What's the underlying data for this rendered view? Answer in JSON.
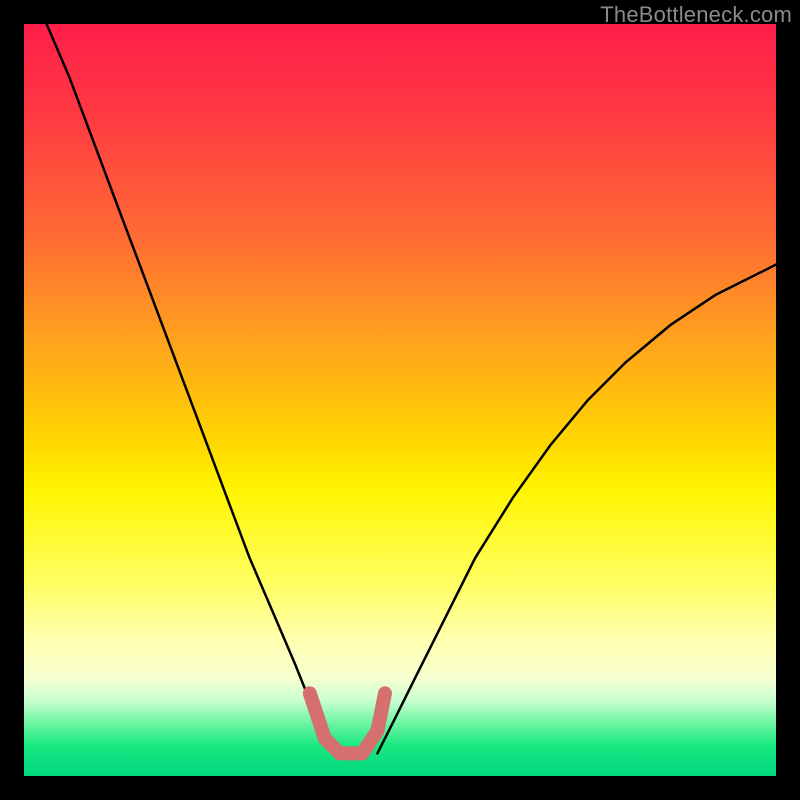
{
  "watermark": "TheBottleneck.com",
  "chart_data": {
    "type": "line",
    "title": "",
    "xlabel": "",
    "ylabel": "",
    "xlim": [
      0,
      100
    ],
    "ylim": [
      0,
      100
    ],
    "note": "Axes and units are not labeled in the source image; x/y expressed as 0–100 percent of the plot area. y = bottleneck severity (top = high / red, bottom = low / green). The two black curves form a V-shaped dip to near-zero (green); a short pink segment marks the trough region.",
    "series": [
      {
        "name": "left-curve",
        "color": "#000000",
        "x": [
          3,
          6,
          9,
          12,
          15,
          18,
          21,
          24,
          27,
          30,
          33,
          36,
          38,
          40,
          41
        ],
        "y": [
          100,
          93,
          85,
          77,
          69,
          61,
          53,
          45,
          37,
          29,
          22,
          15,
          10,
          6,
          3
        ]
      },
      {
        "name": "right-curve",
        "color": "#000000",
        "x": [
          47,
          49,
          52,
          56,
          60,
          65,
          70,
          75,
          80,
          86,
          92,
          100
        ],
        "y": [
          3,
          7,
          13,
          21,
          29,
          37,
          44,
          50,
          55,
          60,
          64,
          68
        ]
      },
      {
        "name": "trough-marker",
        "color": "#d6706f",
        "x": [
          38,
          40,
          42,
          45,
          47,
          48
        ],
        "y": [
          11,
          5,
          3,
          3,
          6,
          11
        ]
      }
    ]
  }
}
